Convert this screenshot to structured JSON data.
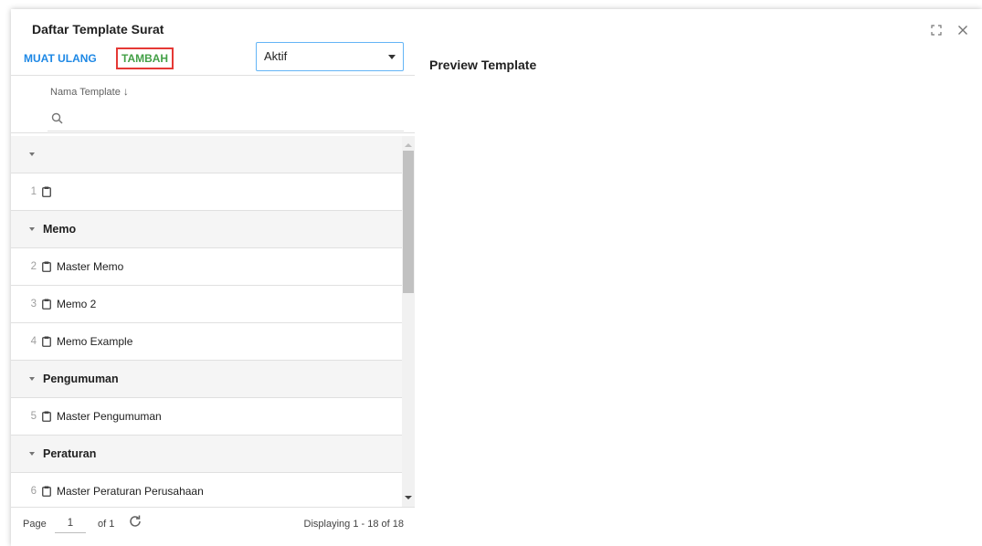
{
  "window": {
    "title": "Daftar Template Surat"
  },
  "toolbar": {
    "reload_label": "MUAT ULANG",
    "add_label": "TAMBAH",
    "status_value": "Aktif"
  },
  "grid": {
    "column_header": "Nama Template",
    "sort_indicator": "↓",
    "rows": [
      {
        "type": "group",
        "label": ""
      },
      {
        "type": "item",
        "num": "1",
        "name": ""
      },
      {
        "type": "group",
        "label": "Memo"
      },
      {
        "type": "item",
        "num": "2",
        "name": "Master Memo"
      },
      {
        "type": "item",
        "num": "3",
        "name": "Memo 2"
      },
      {
        "type": "item",
        "num": "4",
        "name": "Memo Example"
      },
      {
        "type": "group",
        "label": "Pengumuman"
      },
      {
        "type": "item",
        "num": "5",
        "name": "Master Pengumuman"
      },
      {
        "type": "group",
        "label": "Peraturan"
      },
      {
        "type": "item",
        "num": "6",
        "name": "Master Peraturan Perusahaan"
      }
    ]
  },
  "pager": {
    "page_label": "Page",
    "page_value": "1",
    "of_label": "of 1",
    "display_text": "Displaying 1 - 18 of 18"
  },
  "preview": {
    "title": "Preview Template"
  },
  "colors": {
    "reload": "#1e88e5",
    "add": "#43a047",
    "add_highlight": "#e53935",
    "select_border": "#64b5f6"
  },
  "icons": {
    "maximize": "maximize-icon",
    "close": "close-icon",
    "search": "search-icon",
    "clipboard": "clipboard-icon",
    "refresh": "refresh-icon"
  }
}
